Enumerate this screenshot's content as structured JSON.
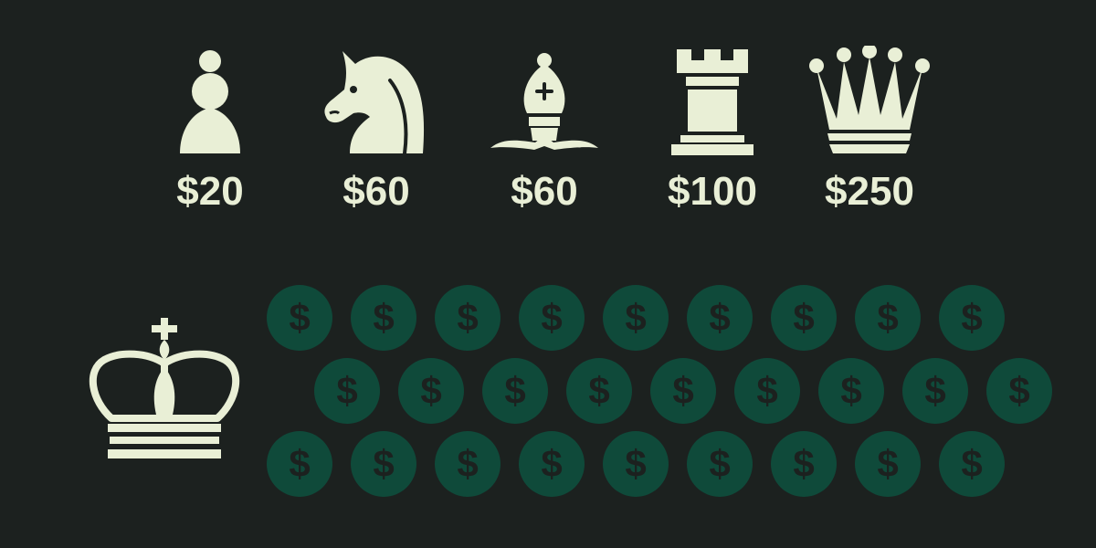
{
  "colors": {
    "background": "#1c211f",
    "piece": "#e9efd6",
    "coin": "#0f4a3a",
    "coin_glyph": "#1c211f"
  },
  "pieces": [
    {
      "name": "pawn",
      "icon": "pawn-icon",
      "price": "$20"
    },
    {
      "name": "knight",
      "icon": "knight-icon",
      "price": "$60"
    },
    {
      "name": "bishop",
      "icon": "bishop-icon",
      "price": "$60"
    },
    {
      "name": "rook",
      "icon": "rook-icon",
      "price": "$100"
    },
    {
      "name": "queen",
      "icon": "queen-icon",
      "price": "$250"
    }
  ],
  "king": {
    "icon": "king-icon"
  },
  "coins": {
    "symbol": "$",
    "rows": [
      9,
      9,
      9
    ]
  }
}
